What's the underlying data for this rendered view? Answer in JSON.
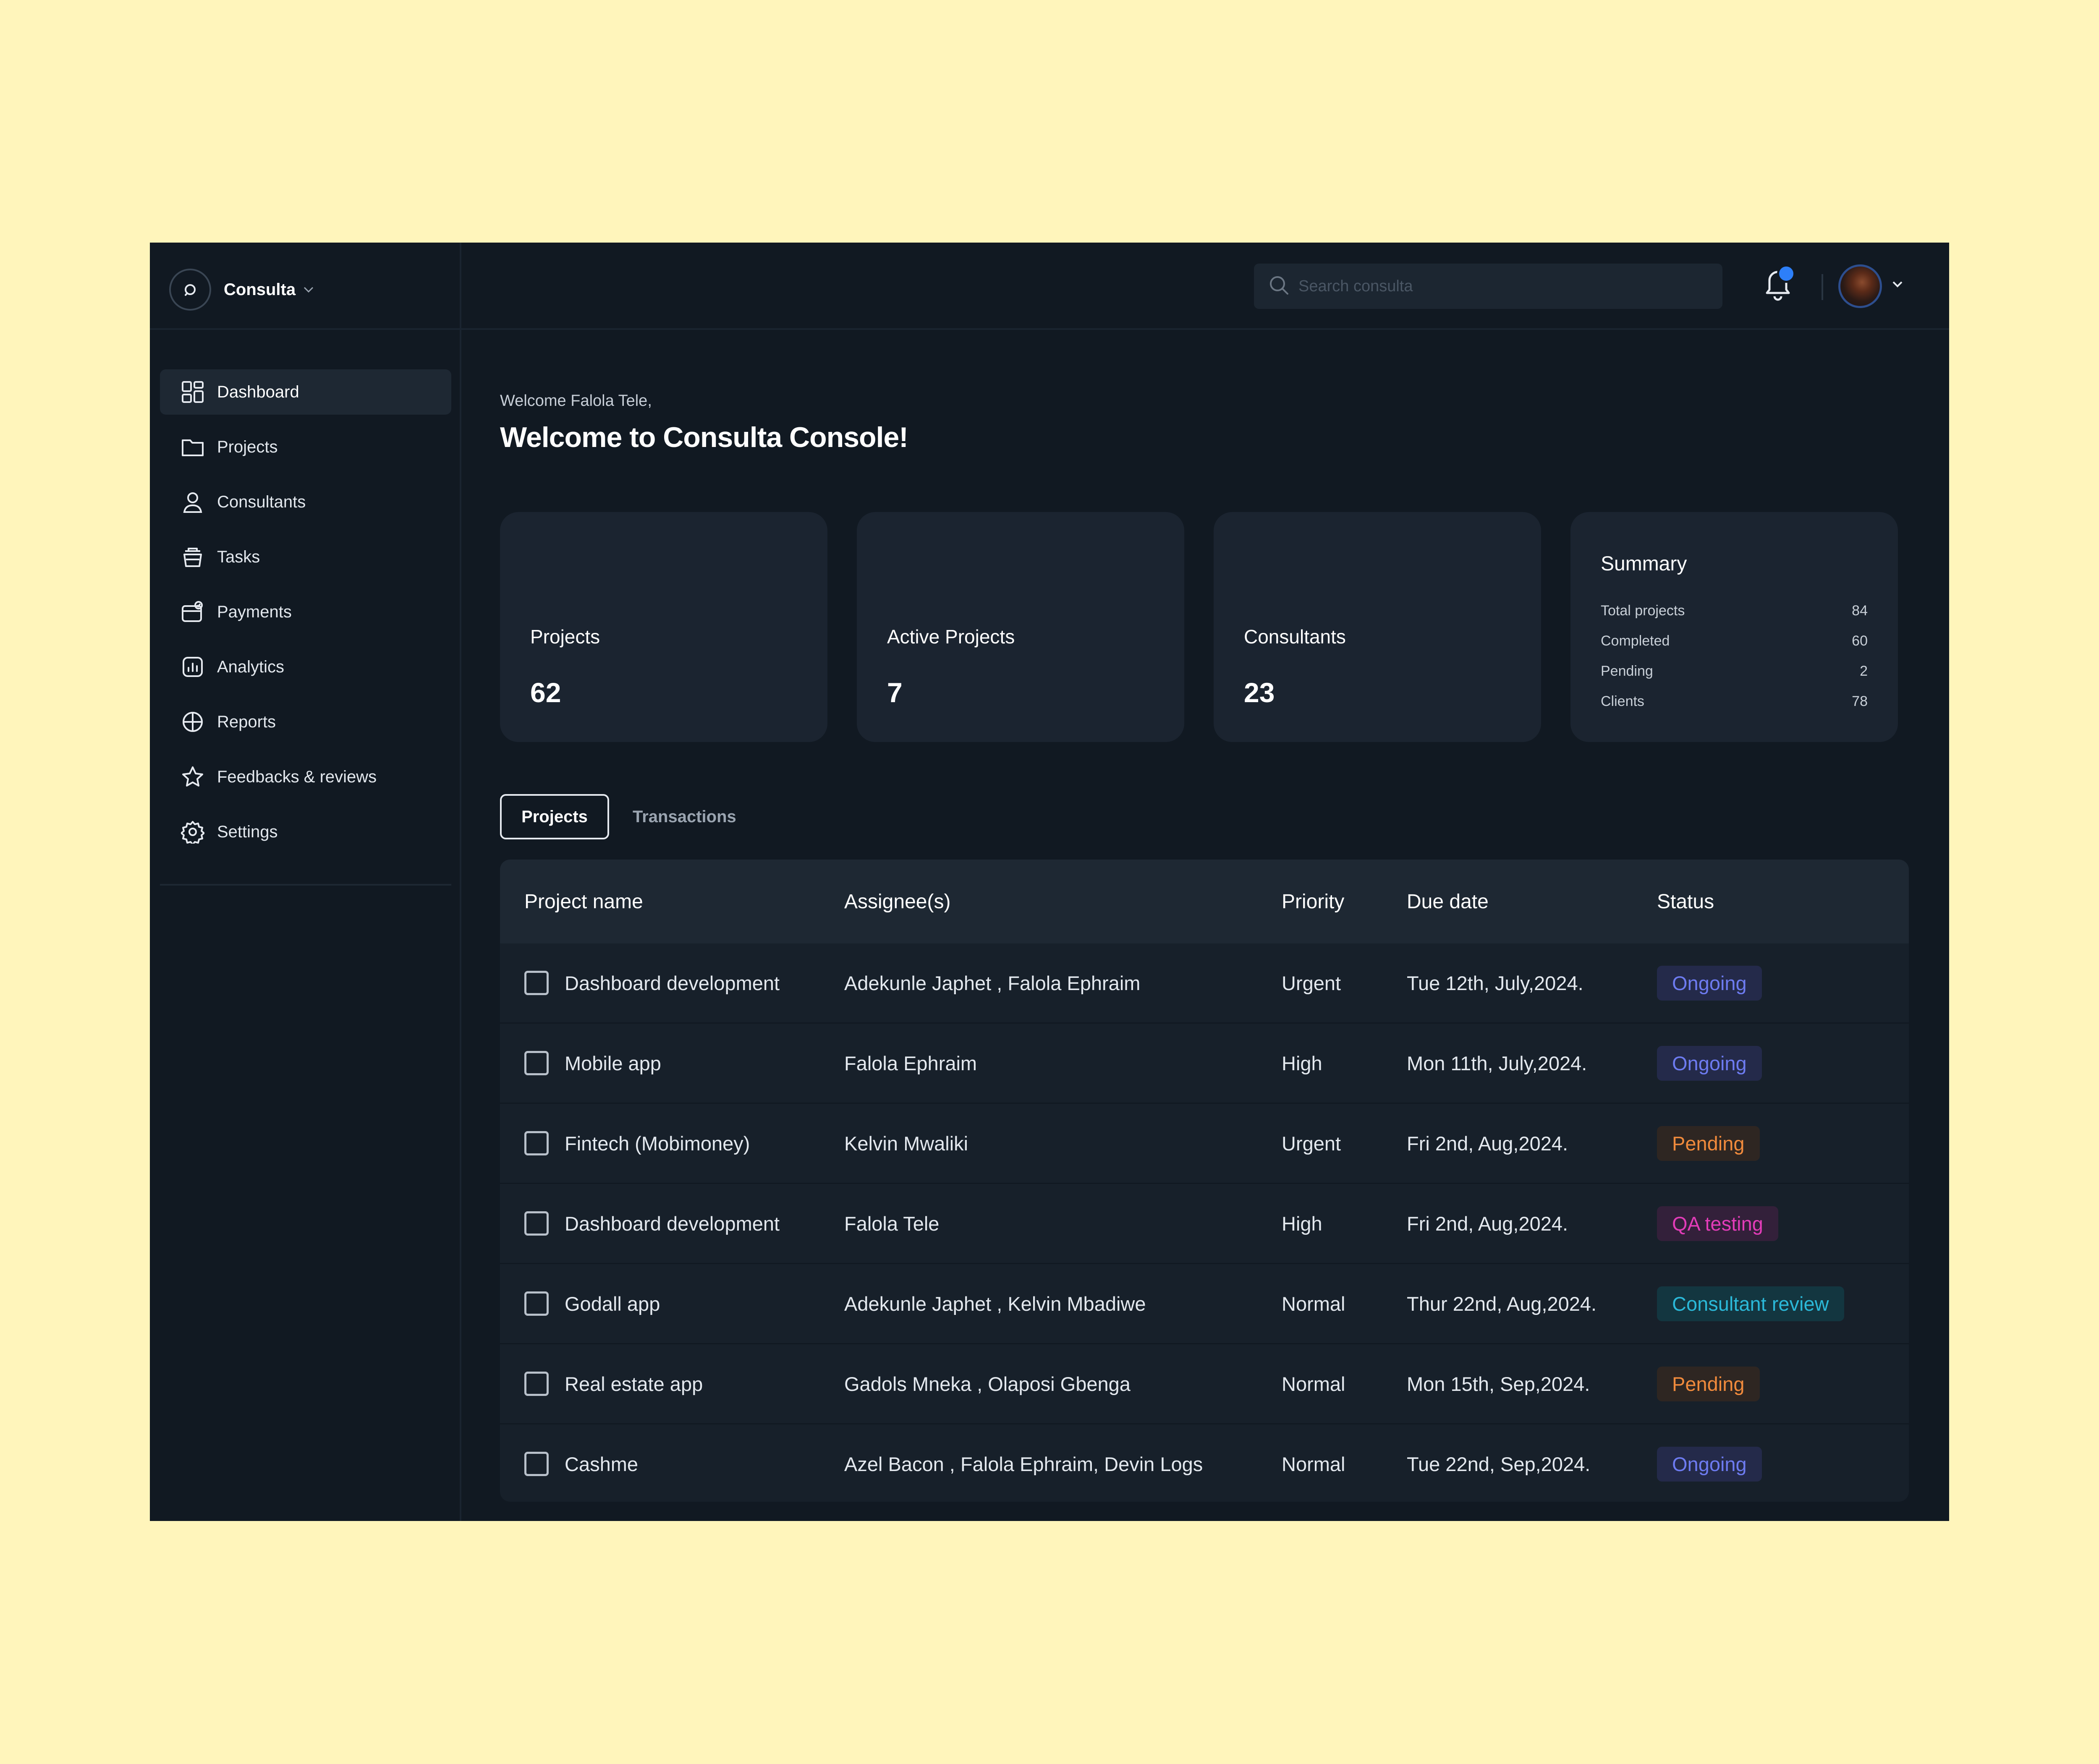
{
  "brand": {
    "name": "Consulta"
  },
  "search": {
    "placeholder": "Search consulta"
  },
  "sidebar": {
    "items": [
      {
        "label": "Dashboard",
        "icon": "dashboard-grid-icon",
        "active": true
      },
      {
        "label": "Projects",
        "icon": "folder-icon",
        "active": false
      },
      {
        "label": "Consultants",
        "icon": "user-icon",
        "active": false
      },
      {
        "label": "Tasks",
        "icon": "tasks-cup-icon",
        "active": false
      },
      {
        "label": "Payments",
        "icon": "wallet-icon",
        "active": false
      },
      {
        "label": "Analytics",
        "icon": "bar-chart-icon",
        "active": false
      },
      {
        "label": "Reports",
        "icon": "pie-chart-icon",
        "active": false
      },
      {
        "label": "Feedbacks & reviews",
        "icon": "star-icon",
        "active": false
      },
      {
        "label": "Settings",
        "icon": "gear-icon",
        "active": false
      }
    ]
  },
  "header": {
    "greeting": "Welcome Falola Tele,",
    "title": "Welcome to Consulta Console!"
  },
  "cards": {
    "projects": {
      "label": "Projects",
      "value": "62"
    },
    "active_projects": {
      "label": "Active Projects",
      "value": "7"
    },
    "consultants": {
      "label": "Consultants",
      "value": "23"
    }
  },
  "summary": {
    "title": "Summary",
    "rows": [
      {
        "label": "Total projects",
        "value": "84"
      },
      {
        "label": "Completed",
        "value": "60"
      },
      {
        "label": "Pending",
        "value": "2"
      },
      {
        "label": "Clients",
        "value": "78"
      }
    ]
  },
  "tabs": {
    "projects": "Projects",
    "transactions": "Transactions"
  },
  "table": {
    "columns": {
      "name": "Project name",
      "assignees": "Assignee(s)",
      "priority": "Priority",
      "due": "Due date",
      "status": "Status"
    },
    "rows": [
      {
        "name": "Dashboard development",
        "assignees": "Adekunle Japhet , Falola Ephraim",
        "priority": "Urgent",
        "due": "Tue 12th, July,2024.",
        "status": "Ongoing"
      },
      {
        "name": "Mobile app",
        "assignees": "Falola Ephraim",
        "priority": "High",
        "due": "Mon 11th, July,2024.",
        "status": "Ongoing"
      },
      {
        "name": "Fintech (Mobimoney)",
        "assignees": "Kelvin Mwaliki",
        "priority": "Urgent",
        "due": "Fri 2nd, Aug,2024.",
        "status": "Pending"
      },
      {
        "name": "Dashboard development",
        "assignees": "Falola Tele",
        "priority": "High",
        "due": "Fri 2nd, Aug,2024.",
        "status": "QA testing"
      },
      {
        "name": "Godall app",
        "assignees": "Adekunle Japhet , Kelvin Mbadiwe",
        "priority": "Normal",
        "due": "Thur 22nd, Aug,2024.",
        "status": "Consultant review"
      },
      {
        "name": "Real estate app",
        "assignees": "Gadols Mneka , Olaposi Gbenga",
        "priority": "Normal",
        "due": "Mon 15th, Sep,2024.",
        "status": "Pending"
      },
      {
        "name": "Cashme",
        "assignees": "Azel Bacon , Falola Ephraim, Devin Logs",
        "priority": "Normal",
        "due": "Tue 22nd, Sep,2024.",
        "status": "Ongoing"
      }
    ]
  },
  "colors": {
    "background": "#FFF5BB",
    "app": "#111922",
    "card": "#1B2430",
    "notification_dot": "#2D7FF9",
    "status_ongoing": "#6D7BF0",
    "status_pending": "#F08A3C",
    "status_qa": "#E23CB8",
    "status_review": "#2BB8D8"
  }
}
